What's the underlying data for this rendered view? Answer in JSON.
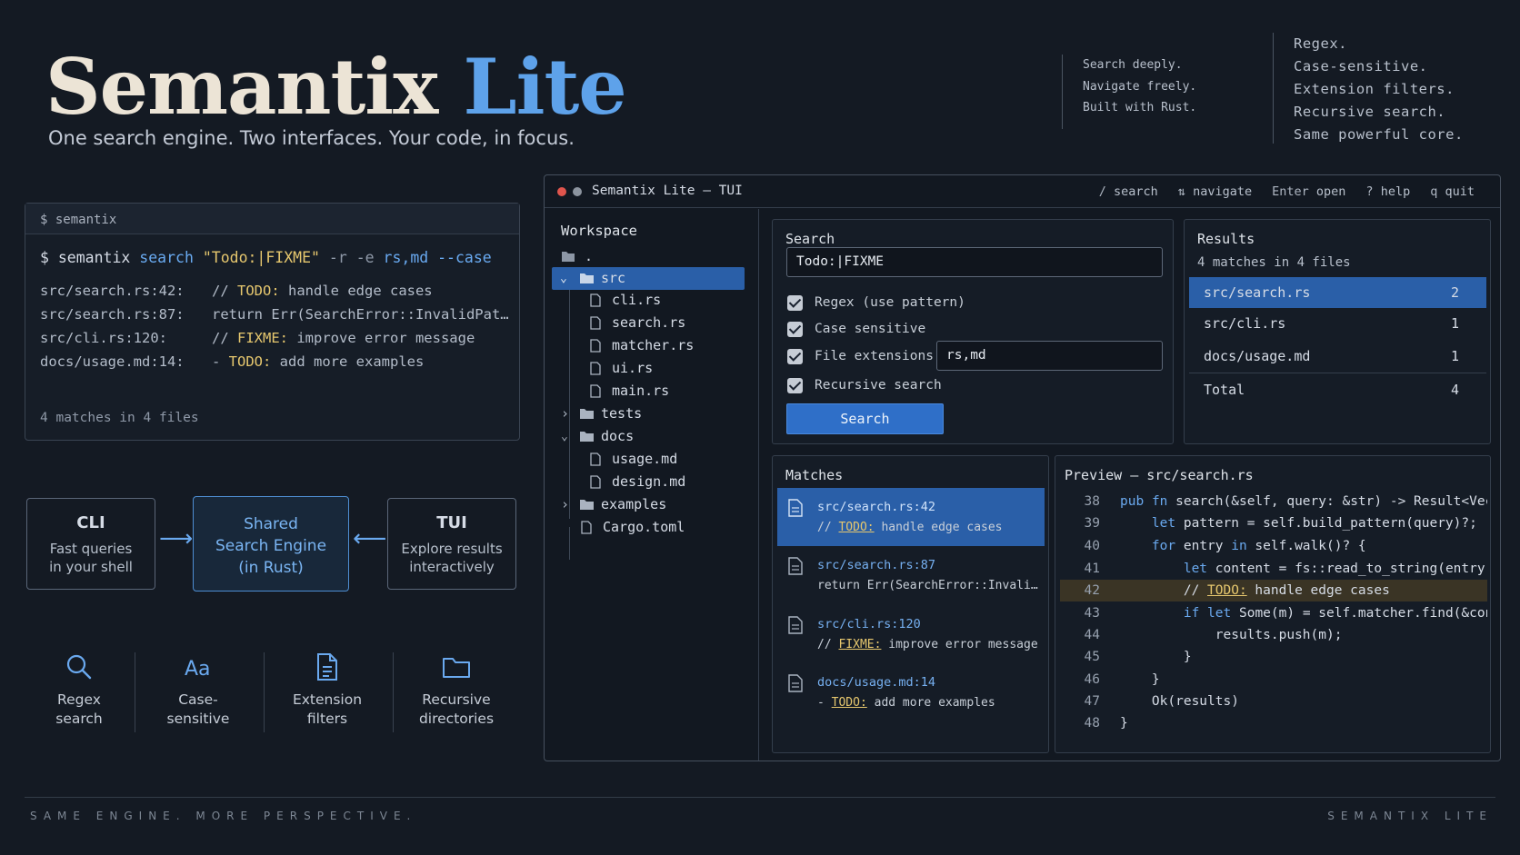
{
  "hero": {
    "title_main": "Semantix",
    "title_accent": "Lite",
    "subtitle": "One search engine. Two interfaces. Your code, in focus.",
    "taglines_a": [
      "Search deeply.",
      "Navigate freely.",
      "Built with Rust."
    ],
    "taglines_b": [
      "Regex.",
      "Case-sensitive.",
      "Extension filters.",
      "Recursive search.",
      "Same powerful core."
    ]
  },
  "cli": {
    "header": "$ semantix",
    "cmd": {
      "prompt": "$ semantix",
      "sub": "search",
      "query": "\"Todo:|FIXME\"",
      "flags1": "-r -e",
      "exts": "rs,md",
      "flag2": "--case"
    },
    "lines": [
      {
        "loc": "src/search.rs:42:",
        "pre": "// ",
        "kw": "TODO:",
        "post": " handle edge cases"
      },
      {
        "loc": "src/search.rs:87:",
        "pre": "return Err(SearchError::InvalidPat…",
        "kw": "",
        "post": ""
      },
      {
        "loc": "src/cli.rs:120:",
        "pre": "// ",
        "kw": "FIXME:",
        "post": " improve error message"
      },
      {
        "loc": "docs/usage.md:14:",
        "pre": "- ",
        "kw": "TODO:",
        "post": " add more examples"
      }
    ],
    "summary": "4 matches in 4 files"
  },
  "diagram": {
    "cli": {
      "title": "CLI",
      "desc": [
        "Fast queries",
        "in your shell"
      ]
    },
    "shared": {
      "desc": [
        "Shared",
        "Search Engine",
        "(in Rust)"
      ]
    },
    "tui": {
      "title": "TUI",
      "desc": [
        "Explore results",
        "interactively"
      ]
    }
  },
  "features": [
    {
      "icon": "search-icon",
      "label": [
        "Regex",
        "search"
      ]
    },
    {
      "icon": "case-icon",
      "label": [
        "Case-",
        "sensitive"
      ]
    },
    {
      "icon": "file-icon",
      "label": [
        "Extension",
        "filters"
      ]
    },
    {
      "icon": "folder-icon",
      "label": [
        "Recursive",
        "directories"
      ]
    }
  ],
  "tui": {
    "title": "Semantix Lite — TUI",
    "keys": [
      {
        "key": "/",
        "label": "search"
      },
      {
        "key": "⇅",
        "label": "navigate"
      },
      {
        "key": "Enter",
        "label": "open"
      },
      {
        "key": "?",
        "label": "help"
      },
      {
        "key": "q",
        "label": "quit"
      }
    ],
    "workspace": {
      "title": "Workspace",
      "root": ".",
      "items": [
        "src",
        "cli.rs",
        "search.rs",
        "matcher.rs",
        "ui.rs",
        "main.rs",
        "tests",
        "docs",
        "usage.md",
        "design.md",
        "examples",
        "Cargo.toml"
      ]
    },
    "search": {
      "title": "Search",
      "query": "Todo:|FIXME",
      "options": [
        "Regex (use pattern)",
        "Case sensitive",
        "File extensions",
        "Recursive search"
      ],
      "checked": [
        true,
        true,
        true,
        true
      ],
      "extensions": "rs,md",
      "button": "Search"
    },
    "results": {
      "title": "Results",
      "summary": "4 matches in 4 files",
      "rows": [
        {
          "file": "src/search.rs",
          "count": "2"
        },
        {
          "file": "src/cli.rs",
          "count": "1"
        },
        {
          "file": "docs/usage.md",
          "count": "1"
        }
      ],
      "total_label": "Total",
      "total": "4"
    },
    "matches": {
      "title": "Matches",
      "items": [
        {
          "loc": "src/search.rs:42",
          "pre": "// ",
          "kw": "TODO:",
          "post": " handle edge cases"
        },
        {
          "loc": "src/search.rs:87",
          "pre": "return Err(SearchError::InvalidPat…",
          "kw": "",
          "post": ""
        },
        {
          "loc": "src/cli.rs:120",
          "pre": "// ",
          "kw": "FIXME:",
          "post": " improve error message"
        },
        {
          "loc": "docs/usage.md:14",
          "pre": "- ",
          "kw": "TODO:",
          "post": " add more examples"
        }
      ]
    },
    "preview": {
      "title": "Preview — src/search.rs",
      "lines": [
        {
          "n": "38",
          "code": "pub fn search(&self, query: &str) -> Result<Vec<Ma"
        },
        {
          "n": "39",
          "code": "    let pattern = self.build_pattern(query)?;"
        },
        {
          "n": "40",
          "code": "    for entry in self.walk()? {"
        },
        {
          "n": "41",
          "code": "        let content = fs::read_to_string(entry.path(I"
        },
        {
          "n": "42",
          "code": "        // TODO: handle edge cases"
        },
        {
          "n": "43",
          "code": "        if let Some(m) = self.matcher.find(&content)"
        },
        {
          "n": "44",
          "code": "            results.push(m);"
        },
        {
          "n": "45",
          "code": "        }"
        },
        {
          "n": "46",
          "code": "    }"
        },
        {
          "n": "47",
          "code": "    Ok(results)"
        },
        {
          "n": "48",
          "code": "}"
        }
      ],
      "highlight_line": "42"
    }
  },
  "footer": {
    "left": "SAME ENGINE. MORE PERSPECTIVE.",
    "right": "SEMANTIX LITE"
  },
  "colors": {
    "accent": "#5ea2ea",
    "selection": "#2a5fa8",
    "keyword": "#e6c76e",
    "background": "#141a23"
  }
}
